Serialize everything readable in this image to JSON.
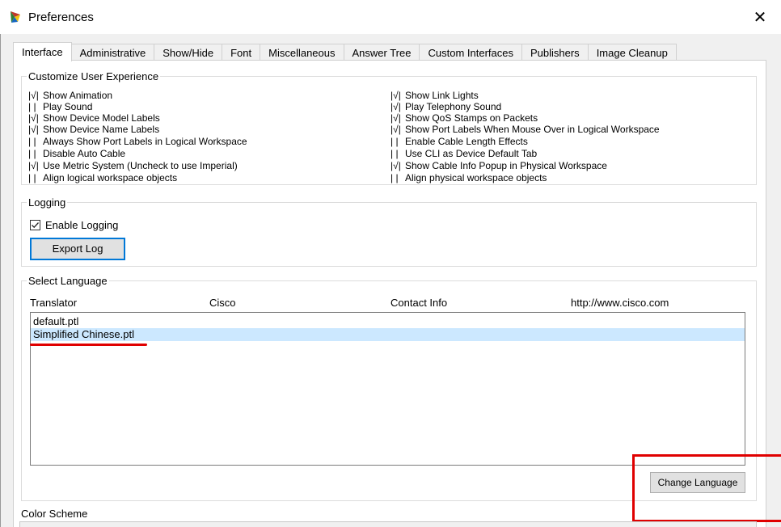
{
  "window": {
    "title": "Preferences",
    "close_glyph": "✕"
  },
  "tabs": [
    {
      "label": "Interface",
      "active": true
    },
    {
      "label": "Administrative"
    },
    {
      "label": "Show/Hide"
    },
    {
      "label": "Font"
    },
    {
      "label": "Miscellaneous"
    },
    {
      "label": "Answer Tree"
    },
    {
      "label": "Custom Interfaces"
    },
    {
      "label": "Publishers"
    },
    {
      "label": "Image Cleanup"
    }
  ],
  "customize": {
    "legend": "Customize User Experience",
    "options_left": [
      {
        "mark": "|√|",
        "label": "Show Animation"
      },
      {
        "mark": "|  |",
        "label": "Play Sound"
      },
      {
        "mark": "|√|",
        "label": "Show Device Model Labels"
      },
      {
        "mark": "|√|",
        "label": "Show Device Name Labels"
      },
      {
        "mark": "|  |",
        "label": "Always Show Port Labels in Logical Workspace"
      },
      {
        "mark": "|  |",
        "label": "Disable Auto Cable"
      },
      {
        "mark": "|√|",
        "label": "Use Metric System (Uncheck to use Imperial)"
      },
      {
        "mark": "|  |",
        "label": "Align logical workspace objects"
      }
    ],
    "options_right": [
      {
        "mark": "|√|",
        "label": "Show Link Lights"
      },
      {
        "mark": "|√|",
        "label": "Play Telephony Sound"
      },
      {
        "mark": "|√|",
        "label": "Show QoS Stamps on Packets"
      },
      {
        "mark": "|√|",
        "label": "Show Port Labels When Mouse Over in Logical Workspace"
      },
      {
        "mark": "|  |",
        "label": "Enable Cable Length Effects"
      },
      {
        "mark": "|  |",
        "label": "Use CLI as Device Default Tab"
      },
      {
        "mark": "|√|",
        "label": "Show Cable Info Popup in Physical Workspace"
      },
      {
        "mark": "|  |",
        "label": "Align physical workspace objects"
      }
    ]
  },
  "logging": {
    "legend": "Logging",
    "enable_label": "Enable Logging",
    "enabled": true,
    "export_button": "Export Log"
  },
  "language": {
    "legend": "Select Language",
    "translator_label": "Translator",
    "translator_value": "Cisco",
    "contact_label": "Contact Info",
    "contact_value": "http://www.cisco.com",
    "items": [
      {
        "label": "default.ptl",
        "selected": false
      },
      {
        "label": "Simplified Chinese.ptl",
        "selected": true
      }
    ],
    "change_button": "Change Language"
  },
  "color_scheme": {
    "legend": "Color Scheme"
  },
  "colors": {
    "selection": "#cce8ff",
    "highlight_red": "#e00000",
    "focus_blue": "#0078d7"
  }
}
